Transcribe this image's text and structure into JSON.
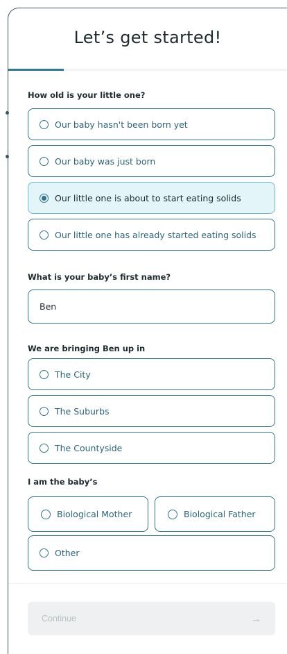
{
  "header": {
    "title": "Let’s get started!",
    "progress": 0.2
  },
  "q_age": {
    "label": "How old is your little one?",
    "options": [
      {
        "label": "Our baby hasn't been born yet",
        "selected": false
      },
      {
        "label": "Our baby was just born",
        "selected": false
      },
      {
        "label": "Our little one is about to start eating solids",
        "selected": true
      },
      {
        "label": "Our little one has already started eating solids",
        "selected": false
      }
    ]
  },
  "q_name": {
    "label": "What is your baby’s first name?",
    "value": "Ben"
  },
  "q_place": {
    "label": "We are bringing Ben up in",
    "options": [
      {
        "label": "The City",
        "selected": false
      },
      {
        "label": "The Suburbs",
        "selected": false
      },
      {
        "label": "The Countyside",
        "selected": false
      }
    ]
  },
  "q_role": {
    "label": "I am the baby’s",
    "options": [
      {
        "label": "Biological Mother",
        "selected": false
      },
      {
        "label": "Biological Father",
        "selected": false
      },
      {
        "label": "Other",
        "selected": false
      }
    ]
  },
  "footer": {
    "continue_label": "Continue",
    "arrow_icon": "arrow-right-icon"
  },
  "colors": {
    "accent": "#2f7489",
    "selected_bg": "#e3f5f8",
    "disabled_bg": "#eef0f1"
  }
}
